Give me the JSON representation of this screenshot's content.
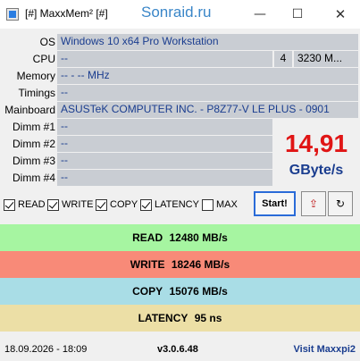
{
  "window": {
    "title": "[#] MaxxMem² [#]",
    "watermark": "Sonraid.ru",
    "min_glyph": "—",
    "max_glyph": "☐",
    "close_glyph": "✕"
  },
  "info": {
    "os_label": "OS",
    "os_value": "Windows 10 x64 Pro Workstation",
    "cpu_label": "CPU",
    "cpu_value": "--",
    "cpu_cores": "4",
    "cpu_freq": "3230 M...",
    "memory_label": "Memory",
    "memory_value": "-- - -- MHz",
    "timings_label": "Timings",
    "timings_value": "--",
    "mainboard_label": "Mainboard",
    "mainboard_value": "ASUSTeK COMPUTER INC. - P8Z77-V LE PLUS - 0901",
    "dimms": [
      {
        "label": "Dimm #1",
        "value": "--"
      },
      {
        "label": "Dimm #2",
        "value": "--"
      },
      {
        "label": "Dimm #3",
        "value": "--"
      },
      {
        "label": "Dimm #4",
        "value": "--"
      }
    ]
  },
  "score": {
    "value": "14,91",
    "unit": "GByte/s",
    "value_color": "#e01515",
    "unit_color": "#1a3d8f"
  },
  "options": {
    "read": {
      "label": "READ",
      "checked": true
    },
    "write": {
      "label": "WRITE",
      "checked": true
    },
    "copy": {
      "label": "COPY",
      "checked": true
    },
    "latency": {
      "label": "LATENCY",
      "checked": true
    },
    "max": {
      "label": "MAX",
      "checked": false
    }
  },
  "buttons": {
    "start": "Start!",
    "export_icon": "export-icon",
    "refresh_icon": "refresh-icon",
    "export_glyph": "⇪",
    "refresh_glyph": "↻"
  },
  "results": [
    {
      "label": "READ",
      "value": "12480 MB/s",
      "color": "#a6f5a1"
    },
    {
      "label": "WRITE",
      "value": "18246 MB/s",
      "color": "#f88a78"
    },
    {
      "label": "COPY",
      "value": "15076 MB/s",
      "color": "#a9dde6"
    },
    {
      "label": "LATENCY",
      "value": "95 ns",
      "color": "#ecdfa6"
    }
  ],
  "footer": {
    "date": "18.09.2026 - 18:09",
    "version": "v3.0.6.48",
    "link": "Visit Maxxpi2"
  }
}
